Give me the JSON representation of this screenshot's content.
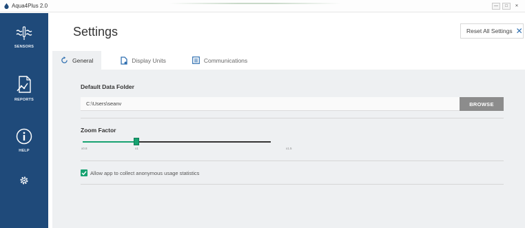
{
  "window": {
    "title": "Aqua4Plus 2.0",
    "icon": "droplet-icon",
    "controls": [
      "minimize-icon",
      "maximize-icon",
      "close-icon"
    ]
  },
  "sidebar": {
    "background": "#1f4a7a",
    "items": [
      {
        "label": "SENSORS",
        "icon": "sensor-waves-icon"
      },
      {
        "label": "REPORTS",
        "icon": "report-chart-icon"
      },
      {
        "label": "HELP",
        "icon": "info-circle-icon"
      },
      {
        "label": "",
        "icon": "gear-icon"
      }
    ]
  },
  "header": {
    "title": "Settings",
    "reset_label": "Reset All Settings",
    "reset_icon": "close-icon"
  },
  "tabs": [
    {
      "label": "General",
      "icon": "refresh-icon",
      "active": true
    },
    {
      "label": "Display Units",
      "icon": "document-icon",
      "active": false
    },
    {
      "label": "Communications",
      "icon": "list-icon",
      "active": false
    }
  ],
  "general": {
    "folder_label": "Default Data Folder",
    "folder_value": "C:\\Users\\seanv",
    "browse_label": "BROWSE",
    "zoom_label": "Zoom Factor",
    "zoom": {
      "min_label": "x0.8",
      "mid_label": "x1",
      "max_label": "x1.5",
      "min": 0.8,
      "max": 1.5,
      "value": 1.0
    },
    "stats_label": "Allow app to collect anonymous usage statistics",
    "stats_checked": true
  },
  "colors": {
    "accent_green": "#17a271",
    "accent_blue": "#2f6fb0",
    "browse_gray": "#8c8c8c"
  }
}
